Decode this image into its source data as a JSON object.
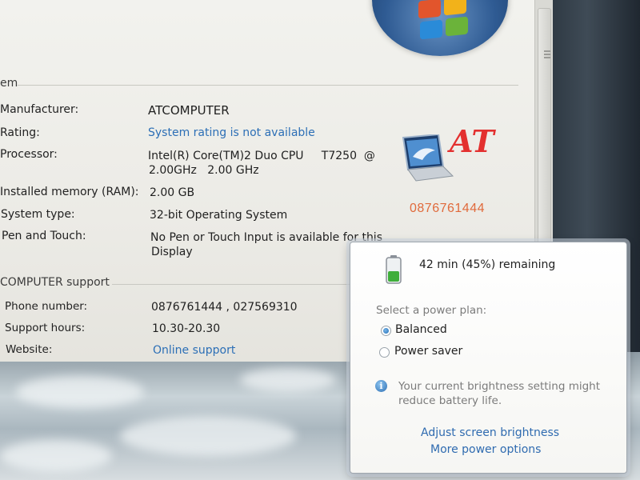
{
  "system": {
    "section_title": "em",
    "rows": [
      {
        "label": "Manufacturer:",
        "value": "ATCOMPUTER"
      },
      {
        "label": "Rating:",
        "value": "System rating is not available"
      },
      {
        "label": "Processor:",
        "value": "Intel(R) Core(TM)2 Duo CPU     T7250  @",
        "value2": "2.00GHz   2.00 GHz"
      },
      {
        "label": "Installed memory (RAM):",
        "value": "2.00 GB"
      },
      {
        "label": "System type:",
        "value": "32-bit Operating System"
      },
      {
        "label": "Pen and Touch:",
        "value": "No Pen or Touch Input is available for this",
        "value2": "Display"
      }
    ]
  },
  "support": {
    "section_title": "COMPUTER support",
    "rows": [
      {
        "label": "Phone number:",
        "value": "0876761444 , 027569310"
      },
      {
        "label": "Support hours:",
        "value": "10.30-20.30"
      },
      {
        "label": "Website:",
        "value": "Online support"
      }
    ]
  },
  "logo": {
    "text": "AT",
    "phone": "0876761444"
  },
  "power": {
    "battery_status": "42 min (45%) remaining",
    "battery_level": 0.45,
    "plan_prompt": "Select a power plan:",
    "plans": [
      {
        "label": "Balanced",
        "selected": true
      },
      {
        "label": "Power saver",
        "selected": false
      }
    ],
    "info_text_line1": "Your current brightness setting might",
    "info_text_line2": "reduce battery life.",
    "adjust_link": "Adjust screen brightness",
    "more_link": "More power options"
  },
  "colors": {
    "link": "#2c6fb6",
    "logo_red": "#e3302f",
    "logo_phone": "#e06a3b",
    "battery_green": "#3fae3a"
  }
}
